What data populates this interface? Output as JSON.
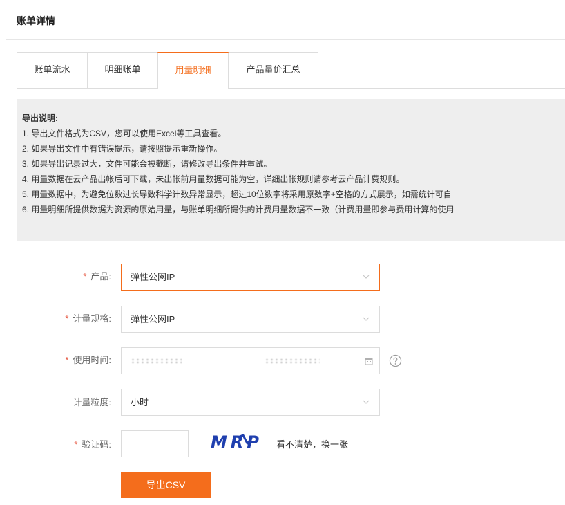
{
  "page": {
    "title": "账单详情"
  },
  "tabs": [
    {
      "label": "账单流水",
      "active": false
    },
    {
      "label": "明细账单",
      "active": false
    },
    {
      "label": "用量明细",
      "active": true
    },
    {
      "label": "产品量价汇总",
      "active": false
    }
  ],
  "notice": {
    "title": "导出说明:",
    "lines": [
      "1. 导出文件格式为CSV，您可以使用Excel等工具查看。",
      "2. 如果导出文件中有错误提示，请按照提示重新操作。",
      "3. 如果导出记录过大，文件可能会被截断，请修改导出条件并重试。",
      "4. 用量数据在云产品出帐后可下载，未出帐前用量数据可能为空，详细出帐规则请参考云产品计费规则。",
      "5. 用量数据中，为避免位数过长导致科学计数异常显示，超过10位数字将采用原数字+空格的方式展示，如需统计可自",
      "6. 用量明细所提供数据为资源的原始用量，与账单明细所提供的计费用量数据不一致（计费用量即参与费用计算的使用"
    ]
  },
  "form": {
    "required_mark": "*",
    "product": {
      "label": "产品:",
      "required": true,
      "value": "弹性公网IP",
      "focused": true
    },
    "spec": {
      "label": "计量规格:",
      "required": true,
      "value": "弹性公网IP"
    },
    "usage_time": {
      "label": "使用时间:",
      "required": true
    },
    "granularity": {
      "label": "计量粒度:",
      "required": false,
      "value": "小时"
    },
    "captcha": {
      "label": "验证码:",
      "required": true,
      "value": "",
      "image_text": "MRP",
      "refresh_label": "看不清楚，换一张"
    },
    "export_button": "导出CSV"
  },
  "icons": {
    "select_arrow": "chevron-down-icon",
    "calendar": "calendar-icon",
    "help": "help-icon"
  },
  "colors": {
    "accent": "#f46d1c",
    "required": "#e5533d",
    "captcha": "#1f3fae",
    "notice_bg": "#eeeeee"
  }
}
